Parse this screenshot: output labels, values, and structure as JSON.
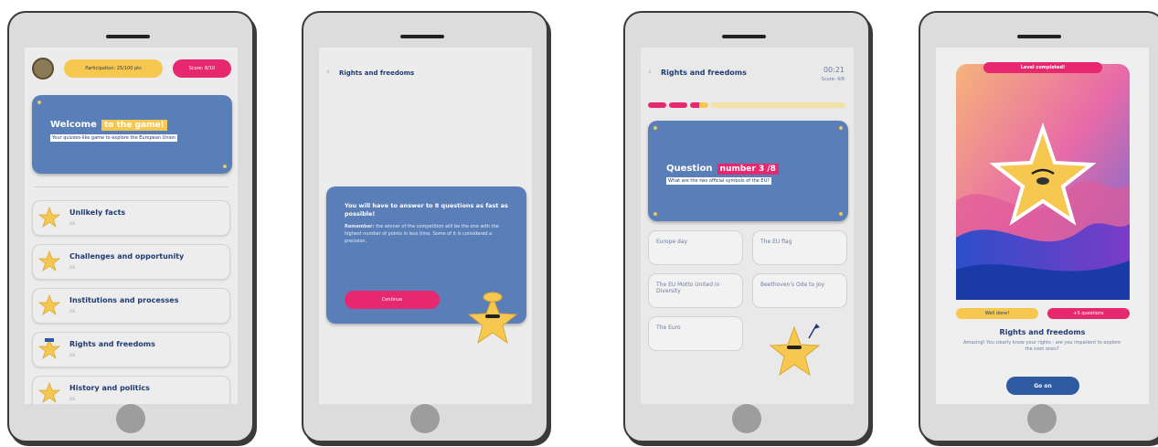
{
  "screen1": {
    "badges": {
      "points": "Participation: 25/100 pts",
      "score": "Score: 8/10"
    },
    "welcome": {
      "title": "Welcome",
      "highlight": "to the game!",
      "subtitle": "Your quizzes-like game to explore the European Union"
    },
    "categories": [
      {
        "label": "Unlikely facts",
        "sub": "0/6"
      },
      {
        "label": "Challenges and opportunity",
        "sub": "0/6"
      },
      {
        "label": "Institutions and processes",
        "sub": "0/6"
      },
      {
        "label": "Rights and freedoms",
        "sub": "0/6"
      },
      {
        "label": "History and politics",
        "sub": "0/6"
      }
    ]
  },
  "screen2": {
    "back": "‹",
    "header": "Rights and freedoms",
    "intro_title": "You will have to answer to 8 questions as fast as possible!",
    "remember_label": "Remember:",
    "intro_body": "the winner of the competition will be the one with the highest number of points in less time. Some of it is considered a precision.",
    "continue_label": "Continue"
  },
  "screen3": {
    "back": "‹",
    "header": "Rights and freedoms",
    "timer": "00:21",
    "score": "Score: 4/8",
    "question_label": "Question",
    "question_number": "number 3 /8",
    "question_text": "What are the two official symbols of the EU?",
    "answers": [
      "Europe day",
      "The EU flag",
      "The EU Motto United in Diversity",
      "Beethoven's Ode to Joy",
      "The Euro"
    ]
  },
  "screen4": {
    "banner": "Level completed!",
    "btn_left": "Well done!",
    "btn_right": "+5 questions",
    "title": "Rights and freedoms",
    "desc": "Amazing! You clearly know your rights - are you impatient to explore the next ones?",
    "cta": "Go on"
  },
  "colors": {
    "blue": "#5a7fb8",
    "navy": "#2d5aa0",
    "yellow": "#f6c850",
    "pink": "#e8286e"
  }
}
